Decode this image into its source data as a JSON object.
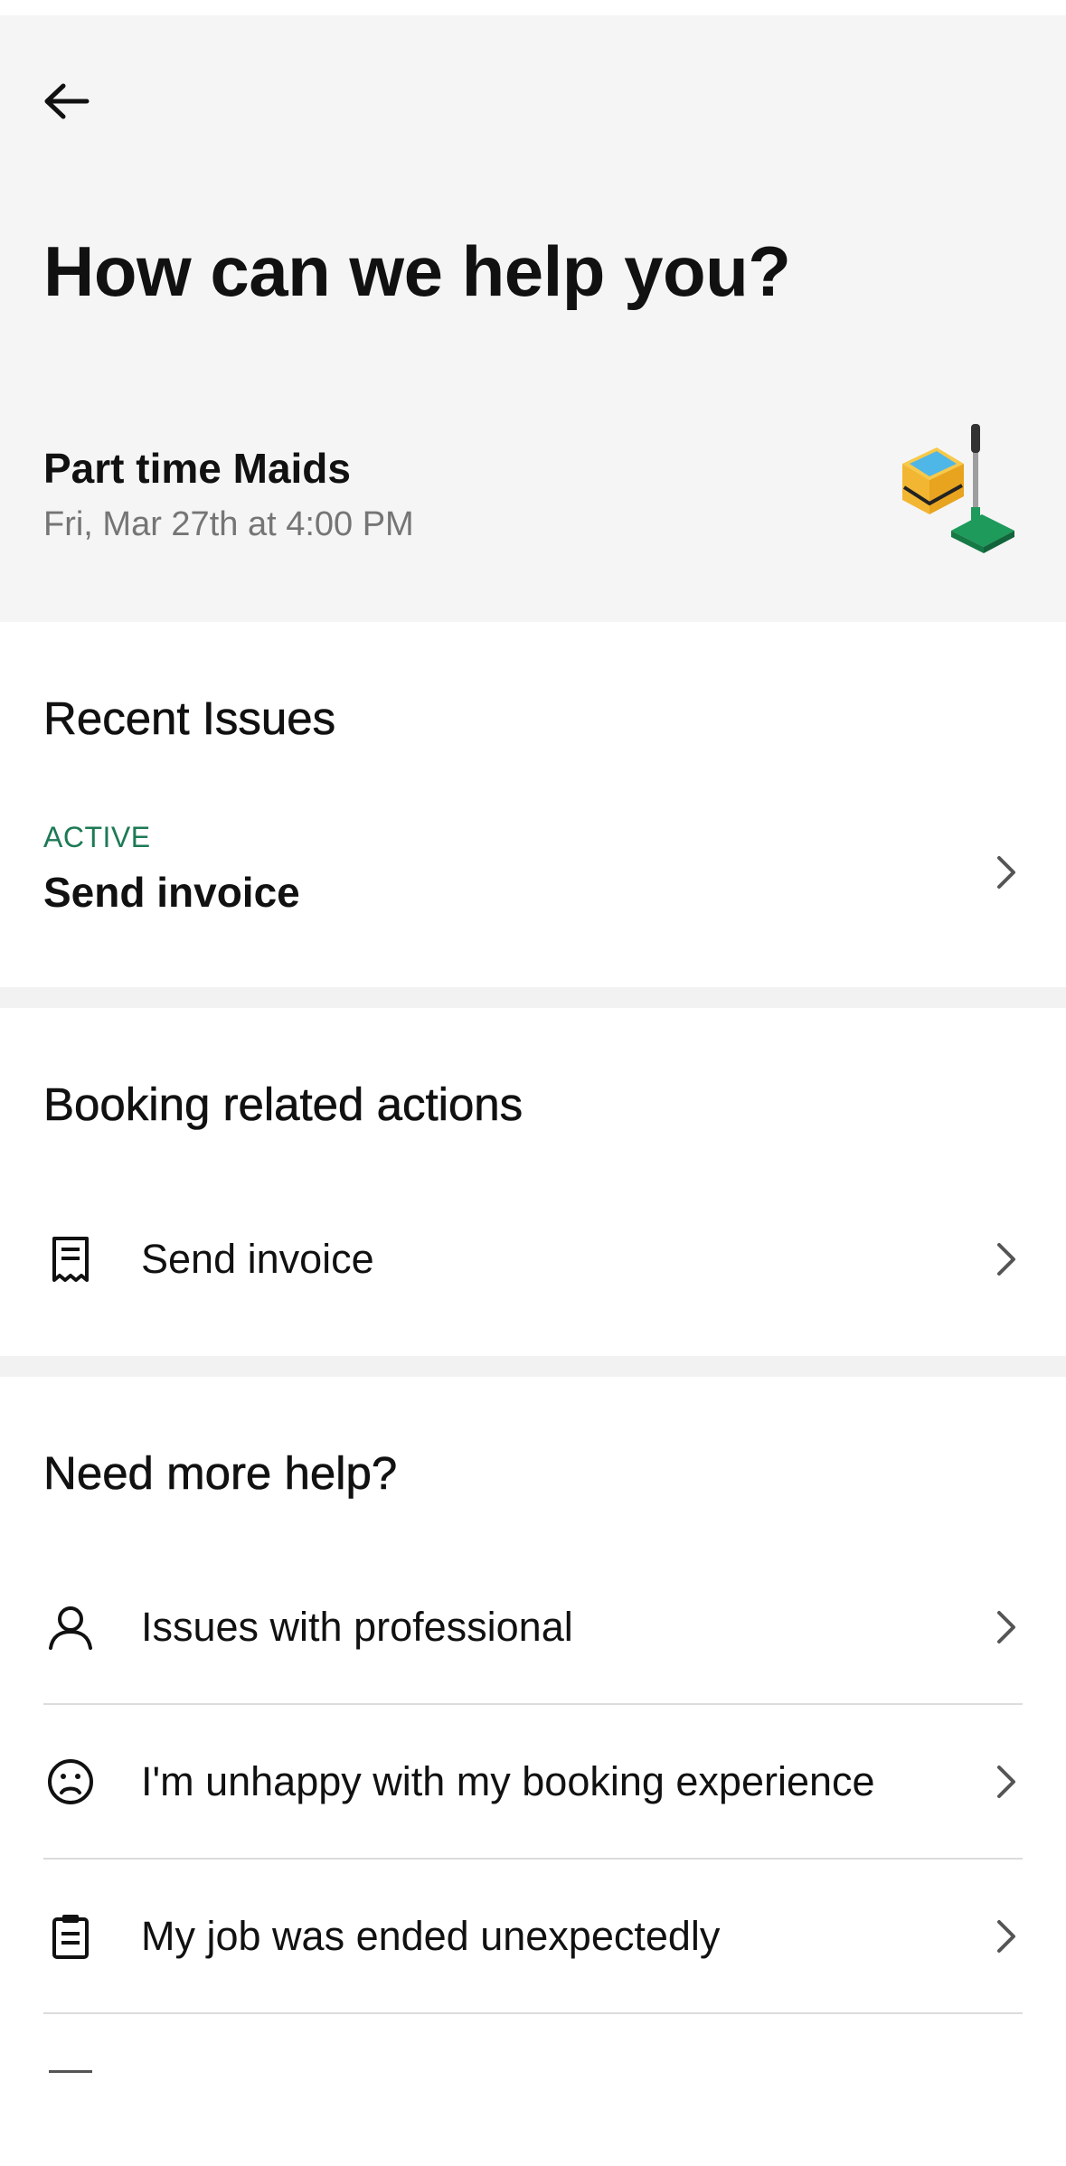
{
  "header": {
    "back_icon": "arrow-left-icon",
    "title": "How can we help you?"
  },
  "booking": {
    "service": "Part time Maids",
    "datetime": "Fri, Mar 27th at 4:00 PM",
    "illustration": "cleaning-bucket-mop-illustration"
  },
  "recent_issues": {
    "title": "Recent Issues",
    "items": [
      {
        "status": "ACTIVE",
        "title": "Send invoice",
        "icon": "chevron-right-icon"
      }
    ]
  },
  "booking_actions": {
    "title": "Booking related actions",
    "items": [
      {
        "label": "Send invoice",
        "icon": "receipt-icon"
      }
    ]
  },
  "more_help": {
    "title": "Need more help?",
    "items": [
      {
        "label": "Issues with professional",
        "icon": "user-icon"
      },
      {
        "label": "I'm unhappy with my booking experience",
        "icon": "sad-face-icon"
      },
      {
        "label": "My job was ended unexpectedly",
        "icon": "clipboard-icon"
      }
    ]
  },
  "colors": {
    "header_bg": "#f5f5f5",
    "active_status": "#1d7a55",
    "text_primary": "#111111",
    "text_secondary": "#757575",
    "divider": "#dcdcdc"
  }
}
